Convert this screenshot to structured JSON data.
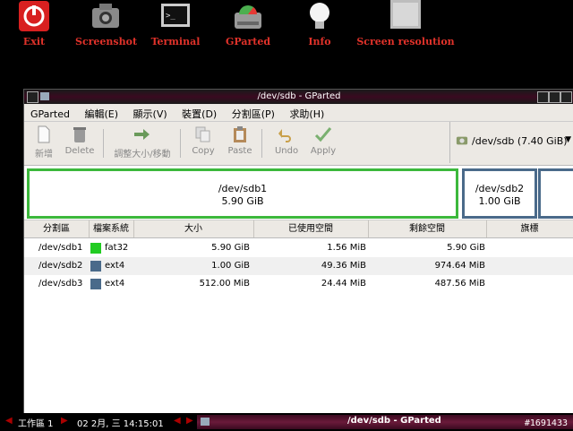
{
  "launchers": [
    {
      "label": "Exit",
      "icon": "power-icon"
    },
    {
      "label": "Screenshot",
      "icon": "camera-icon"
    },
    {
      "label": "Terminal",
      "icon": "terminal-icon"
    },
    {
      "label": "GParted",
      "icon": "disk-icon"
    },
    {
      "label": "Info",
      "icon": "lightbulb-icon"
    },
    {
      "label": "Screen resolution",
      "icon": "monitor-icon"
    }
  ],
  "window": {
    "title": "/dev/sdb - GParted"
  },
  "menu": [
    "GParted",
    "編輯(E)",
    "顯示(V)",
    "裝置(D)",
    "分割區(P)",
    "求助(H)"
  ],
  "toolbar": {
    "new": "新增",
    "delete": "Delete",
    "resize": "調整大小/移動",
    "copy": "Copy",
    "paste": "Paste",
    "undo": "Undo",
    "apply": "Apply",
    "device": "/dev/sdb  (7.40 GiB)"
  },
  "diskmap": [
    {
      "name": "/dev/sdb1",
      "size": "5.90 GiB"
    },
    {
      "name": "/dev/sdb2",
      "size": "1.00 GiB"
    }
  ],
  "columns": [
    "分割區",
    "檔案系統",
    "大小",
    "已使用空間",
    "剩餘空間",
    "旗標"
  ],
  "partitions": [
    {
      "partition": "/dev/sdb1",
      "fs": "fat32",
      "size": "5.90 GiB",
      "used": "1.56 MiB",
      "unused": "5.90 GiB",
      "flags": "",
      "color": "#22cc22"
    },
    {
      "partition": "/dev/sdb2",
      "fs": "ext4",
      "size": "1.00 GiB",
      "used": "49.36 MiB",
      "unused": "974.64 MiB",
      "flags": "",
      "color": "#4a6a8a"
    },
    {
      "partition": "/dev/sdb3",
      "fs": "ext4",
      "size": "512.00 MiB",
      "used": "24.44 MiB",
      "unused": "487.56 MiB",
      "flags": "",
      "color": "#4a6a8a"
    }
  ],
  "taskbar": {
    "workspace": "工作區 1",
    "clock": "02  2月, 三 14:15:01",
    "task": "/dev/sdb - GParted",
    "watermark": "#1691433"
  }
}
